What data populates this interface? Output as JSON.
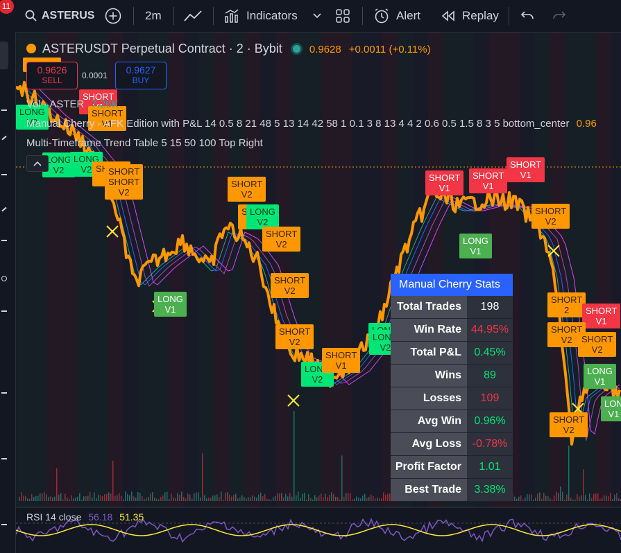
{
  "toolbar": {
    "notifications": "11",
    "symbol": "ASTERUS",
    "interval": "2m",
    "indicators_label": "Indicators",
    "alert_label": "Alert",
    "replay_label": "Replay"
  },
  "header": {
    "title": "ASTERUSDT Perpetual Contract · 2 · Bybit",
    "price": "0.9628",
    "change": "+0.0011 (+0.11%)",
    "sell_price": "0.9626",
    "sell_label": "SELL",
    "spread": "0.0001",
    "buy_price": "0.9627",
    "buy_label": "BUY"
  },
  "legend": {
    "vol": "Vol · ASTER",
    "vol_value": "7.26K",
    "cherry": "Manual Cherry - AFK Edition with P&L 14 0.5 8 21 48 5 13 14 42 58 1 0.1 3 8 13 4 4 2 0.6 0.5 1.5 8 3 5 bottom_center",
    "cherry_value": "0.96",
    "trend": "Multi-Timeframe Trend Table 5 15 50 100 Top Right",
    "collapse_icon": "chevron-up-icon"
  },
  "signals": [
    {
      "text": [
        "SHORT"
      ],
      "kind": "short"
    },
    {
      "text": [
        "LONG",
        "V2"
      ],
      "kind": "longb"
    },
    {
      "text": [
        "SHORT",
        "V1"
      ],
      "kind": "shortr"
    },
    {
      "text": [
        "SHORT",
        "V1"
      ],
      "kind": "short"
    },
    {
      "text": [
        "LONG",
        "V2"
      ],
      "kind": "longb"
    },
    {
      "text": [
        "LONG",
        "V2"
      ],
      "kind": "longb"
    },
    {
      "text": [
        "SHORT",
        "V2"
      ],
      "kind": "short"
    },
    {
      "text": [
        "SHORT",
        "V2"
      ],
      "kind": "short"
    },
    {
      "text": [
        "SHORT",
        "V2"
      ],
      "kind": "short"
    },
    {
      "text": [
        "SHORT",
        "V2"
      ],
      "kind": "short"
    },
    {
      "text": [
        "SHORT",
        "V2"
      ],
      "kind": "short"
    },
    {
      "text": [
        "LONG",
        "V2"
      ],
      "kind": "longb"
    },
    {
      "text": [
        "SHORT",
        "V2"
      ],
      "kind": "short"
    },
    {
      "text": [
        "LONG",
        "V1"
      ],
      "kind": "long"
    },
    {
      "text": [
        "SHORT",
        "V2"
      ],
      "kind": "short"
    },
    {
      "text": [
        "SHORT",
        "V2"
      ],
      "kind": "short"
    },
    {
      "text": [
        "LONG",
        "V2"
      ],
      "kind": "longb"
    },
    {
      "text": [
        "SHORT",
        "V1"
      ],
      "kind": "short"
    },
    {
      "text": [
        "LONG",
        "V2"
      ],
      "kind": "longb"
    },
    {
      "text": [
        "LONG",
        "V2"
      ],
      "kind": "longb"
    },
    {
      "text": [
        "SHORT",
        "V1"
      ],
      "kind": "shortr"
    },
    {
      "text": [
        "SHORT",
        "V1"
      ],
      "kind": "shortr"
    },
    {
      "text": [
        "SHORT",
        "V1"
      ],
      "kind": "shortr"
    },
    {
      "text": [
        "LONG",
        "V1"
      ],
      "kind": "long"
    },
    {
      "text": [
        "SHORT",
        "V2"
      ],
      "kind": "short"
    },
    {
      "text": [
        "SHORT",
        "2"
      ],
      "kind": "short"
    },
    {
      "text": [
        "SHORT",
        "V1"
      ],
      "kind": "shortr"
    },
    {
      "text": [
        "SHORT",
        "V2"
      ],
      "kind": "short"
    },
    {
      "text": [
        "SHORT",
        "V2"
      ],
      "kind": "short"
    },
    {
      "text": [
        "LONG",
        "V1"
      ],
      "kind": "long"
    },
    {
      "text": [
        "SHORT",
        "V2"
      ],
      "kind": "short"
    },
    {
      "text": [
        "LON",
        "V1"
      ],
      "kind": "long"
    }
  ],
  "stats": {
    "title": "Manual Cherry Stats",
    "rows": [
      {
        "label": "Total Trades",
        "value": "198",
        "color": "#ffffff"
      },
      {
        "label": "Win Rate",
        "value": "44.95%",
        "color": "#f23645"
      },
      {
        "label": "Total P&L",
        "value": "0.45%",
        "color": "#00e676"
      },
      {
        "label": "Wins",
        "value": "89",
        "color": "#00e676"
      },
      {
        "label": "Losses",
        "value": "109",
        "color": "#f23645"
      },
      {
        "label": "Avg Win",
        "value": "0.96%",
        "color": "#00e676"
      },
      {
        "label": "Avg Loss",
        "value": "-0.78%",
        "color": "#f23645"
      },
      {
        "label": "Profit Factor",
        "value": "1.01",
        "color": "#00e676"
      },
      {
        "label": "Best Trade",
        "value": "3.38%",
        "color": "#00e676"
      }
    ]
  },
  "rsi": {
    "label": "RSI 14 close",
    "value1": "56.18",
    "value2": "51.35"
  },
  "colors": {
    "accent": "#2962ff",
    "price": "#ff9800",
    "up": "#00e676",
    "down": "#f23645"
  }
}
